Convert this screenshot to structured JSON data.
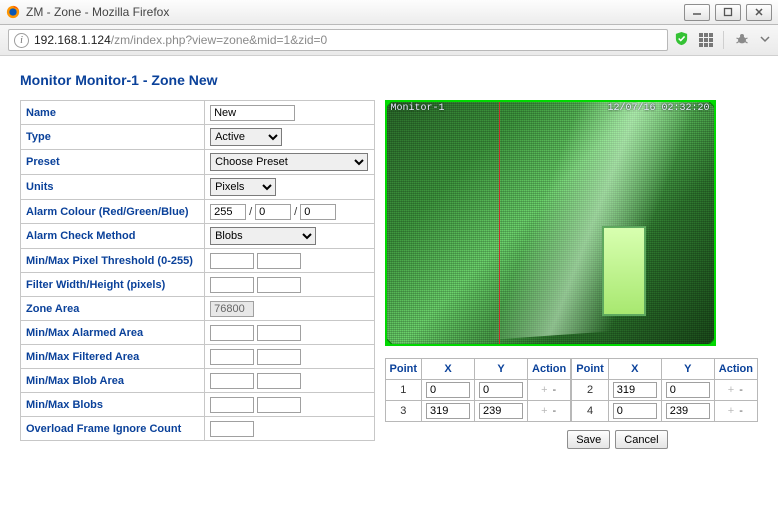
{
  "window": {
    "title": "ZM - Zone - Mozilla Firefox",
    "url_host": "192.168.1.124",
    "url_path": "/zm/index.php?view=zone&mid=1&zid=0"
  },
  "page_title": "Monitor Monitor-1 - Zone New",
  "preview_overlay": {
    "left": "Monitor-1",
    "right": "12/07/16 02:32:20"
  },
  "form": {
    "name": {
      "label": "Name",
      "value": "New"
    },
    "type": {
      "label": "Type",
      "value": "Active"
    },
    "preset": {
      "label": "Preset",
      "value": "Choose Preset"
    },
    "units": {
      "label": "Units",
      "value": "Pixels"
    },
    "alarm_colour": {
      "label": "Alarm Colour (Red/Green/Blue)",
      "r": "255",
      "g": "0",
      "b": "0"
    },
    "alarm_check": {
      "label": "Alarm Check Method",
      "value": "Blobs"
    },
    "pixel_thresh": {
      "label": "Min/Max Pixel Threshold (0-255)",
      "min": "",
      "max": ""
    },
    "filter_wh": {
      "label": "Filter Width/Height (pixels)",
      "w": "",
      "h": ""
    },
    "zone_area": {
      "label": "Zone Area",
      "value": "76800"
    },
    "alarmed_area": {
      "label": "Min/Max Alarmed Area",
      "min": "",
      "max": ""
    },
    "filtered_area": {
      "label": "Min/Max Filtered Area",
      "min": "",
      "max": ""
    },
    "blob_area": {
      "label": "Min/Max Blob Area",
      "min": "",
      "max": ""
    },
    "blobs": {
      "label": "Min/Max Blobs",
      "min": "",
      "max": ""
    },
    "overload": {
      "label": "Overload Frame Ignore Count",
      "value": ""
    }
  },
  "points_headers": {
    "point": "Point",
    "x": "X",
    "y": "Y",
    "action": "Action"
  },
  "points": [
    {
      "n": "1",
      "x": "0",
      "y": "0"
    },
    {
      "n": "2",
      "x": "319",
      "y": "0"
    },
    {
      "n": "3",
      "x": "319",
      "y": "239"
    },
    {
      "n": "4",
      "x": "0",
      "y": "239"
    }
  ],
  "buttons": {
    "save": "Save",
    "cancel": "Cancel"
  }
}
